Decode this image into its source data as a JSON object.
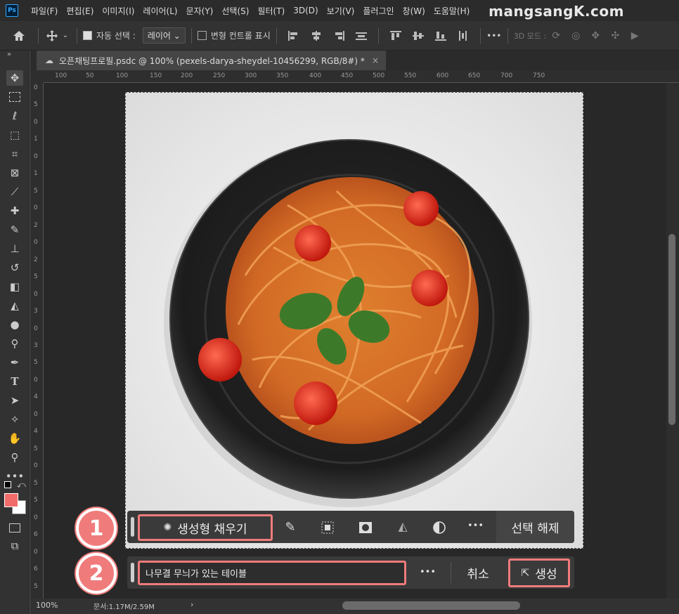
{
  "menubar": {
    "logo": "Ps",
    "items": [
      "파일(F)",
      "편집(E)",
      "이미지(I)",
      "레이어(L)",
      "문자(Y)",
      "선택(S)",
      "필터(T)",
      "3D(D)",
      "보기(V)",
      "플러그인",
      "창(W)",
      "도움말(H)"
    ],
    "watermark": "mangsangK.com"
  },
  "options": {
    "auto_select_label": "자동 선택 :",
    "auto_select_value": "레이어",
    "transform_controls_label": "변형 컨트롤 표시",
    "more_label": "•••",
    "mode_3d_label": "3D 모드 :"
  },
  "document": {
    "tab_title": "오픈채팅프로필.psdc @ 100% (pexels-darya-sheydel-10456299, RGB/8#) *",
    "close_glyph": "×"
  },
  "rulers": {
    "horizontal_ticks": [
      "100",
      "50",
      "100",
      "150",
      "200",
      "250",
      "300",
      "350",
      "400",
      "450",
      "500",
      "550",
      "600",
      "650",
      "700",
      "750"
    ],
    "vertical_ticks": [
      "0",
      "5",
      "0",
      "1",
      "0",
      "1",
      "5",
      "0",
      "2",
      "0",
      "2",
      "5",
      "0",
      "3",
      "0",
      "3",
      "5",
      "0",
      "4",
      "0",
      "4",
      "5",
      "0",
      "5",
      "5",
      "0",
      "6",
      "0",
      "6",
      "5"
    ]
  },
  "status": {
    "zoom": "100%",
    "doc_size": "문서:1.17M/2.59M",
    "arrow": "›"
  },
  "taskbar": {
    "generative_fill_label": "생성형 채우기",
    "more_label": "•••",
    "deselect_label": "선택 해제"
  },
  "promptbar": {
    "prompt_value": "나무결 무늬가 있는 테이블",
    "more_label": "•••",
    "cancel_label": "취소",
    "generate_label": "생성"
  },
  "annotations": {
    "step1": "1",
    "step2": "2"
  },
  "colors": {
    "highlight": "#f07b7b",
    "foreground_swatch": "#f26b6b",
    "background_swatch": "#ffffff"
  }
}
